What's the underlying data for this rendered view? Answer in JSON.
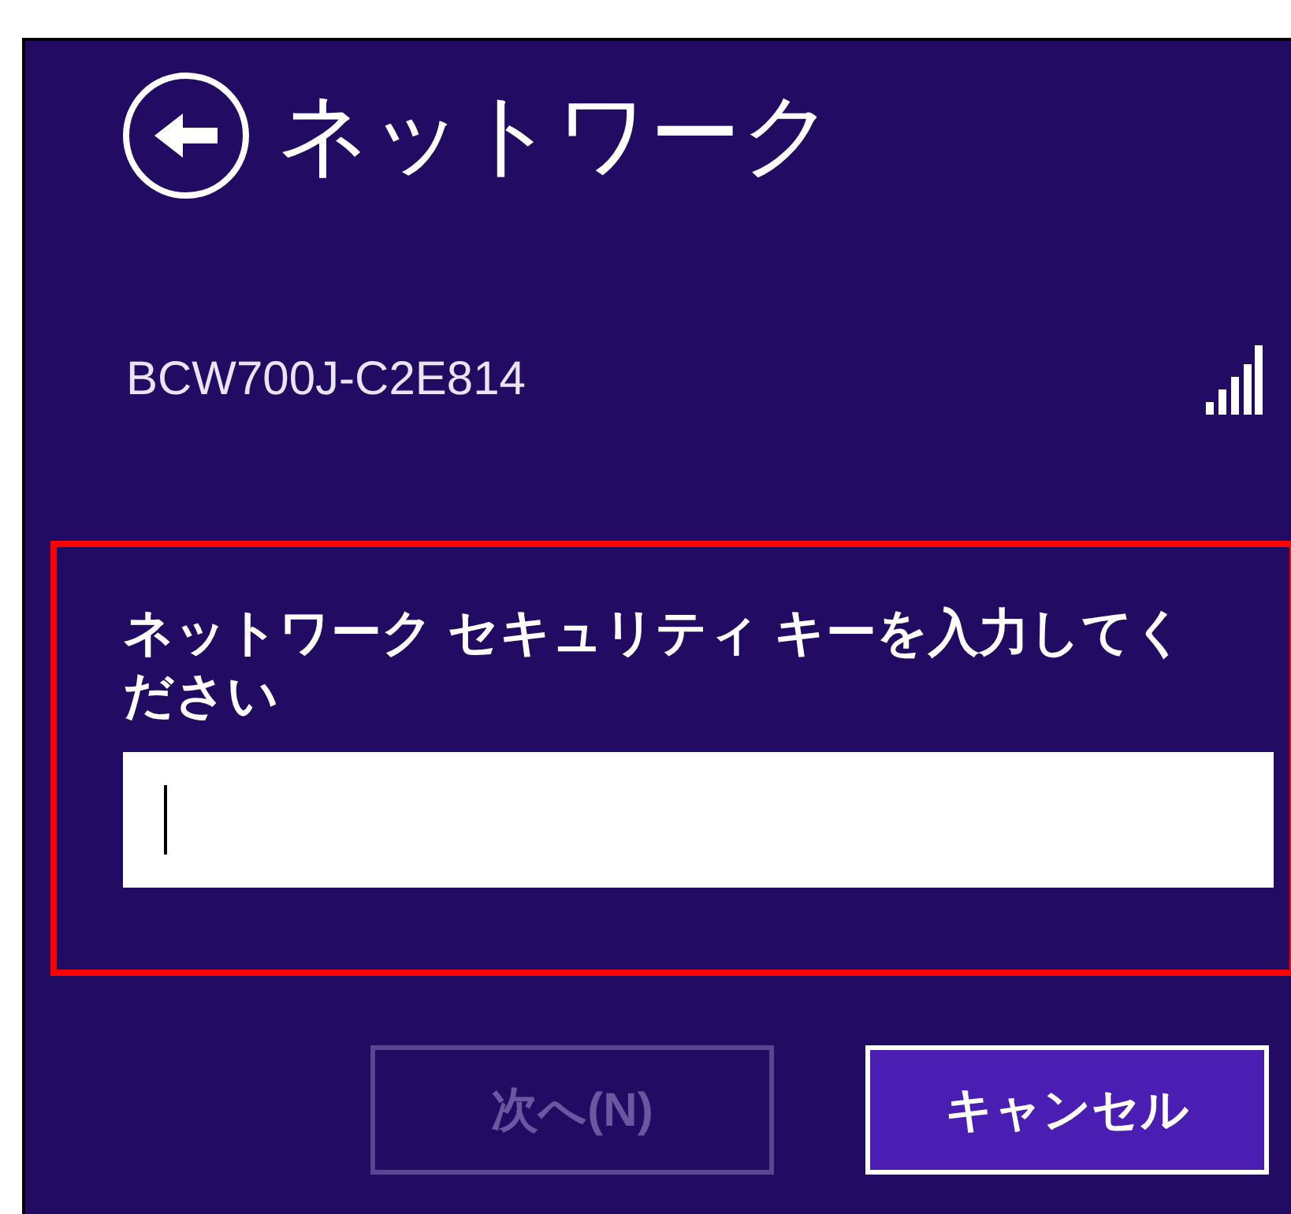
{
  "header": {
    "title": "ネットワーク"
  },
  "network": {
    "name": "BCW700J-C2E814"
  },
  "security_key": {
    "label": "ネットワーク セキュリティ キーを入力してください",
    "focused": true
  },
  "buttons": [
    {
      "label": "次へ(N)",
      "disabled": true
    },
    {
      "label": "キャンセル",
      "disabled": false
    }
  ]
}
